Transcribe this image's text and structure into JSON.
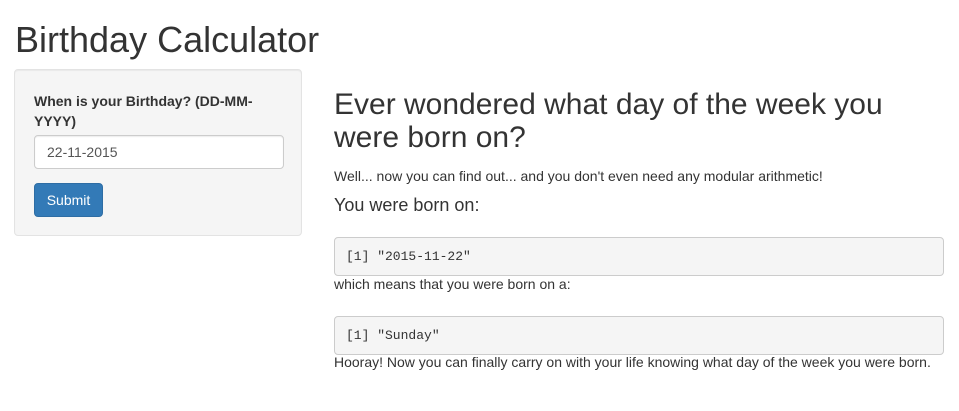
{
  "app": {
    "title": "Birthday Calculator"
  },
  "sidebar": {
    "input_label": "When is your Birthday? (DD-MM-YYYY)",
    "input_value": "22-11-2015",
    "submit_label": "Submit"
  },
  "main": {
    "heading": "Ever wondered what day of the week you were born on?",
    "intro": "Well... now you can find out... and you don't even need any modular arithmetic!",
    "born_on_heading": "You were born on:",
    "date_output": "[1] \"2015-11-22\"",
    "means_text": "which means that you were born on a:",
    "day_output": "[1] \"Sunday\"",
    "closing": "Hooray! Now you can finally carry on with your life knowing what day of the week you were born."
  },
  "colors": {
    "primary_button": "#337ab7",
    "panel_background": "#f5f5f5",
    "text": "#333333"
  }
}
